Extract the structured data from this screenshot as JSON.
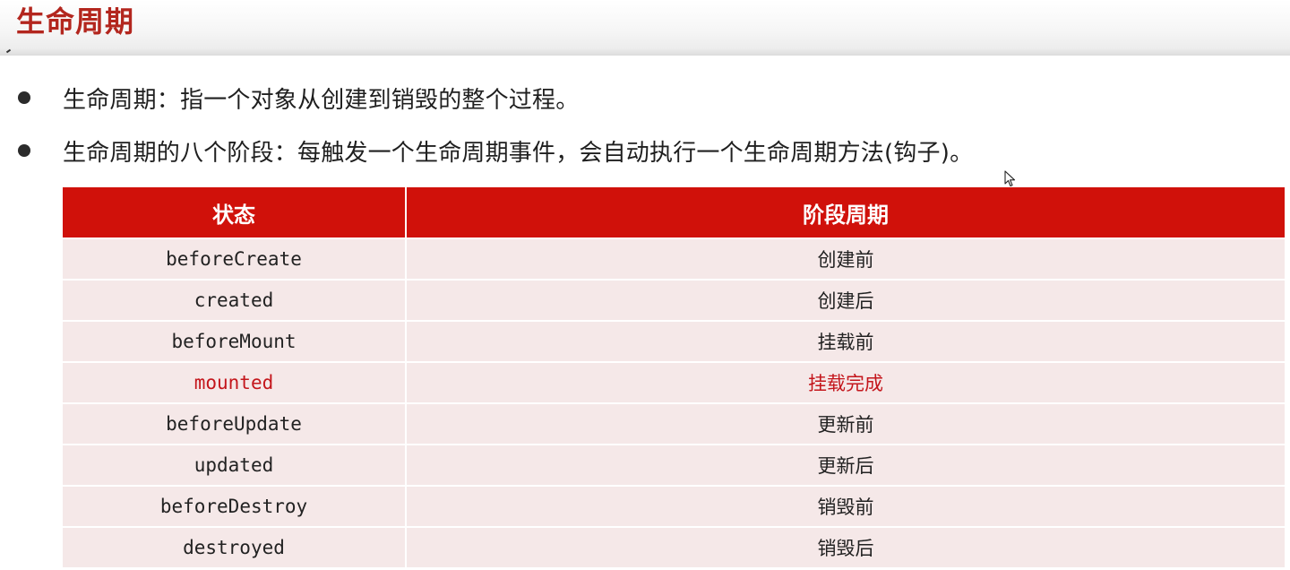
{
  "page": {
    "title": "生命周期"
  },
  "bullets": [
    {
      "text": "生命周期：指一个对象从创建到销毁的整个过程。"
    },
    {
      "text": "生命周期的八个阶段：每触发一个生命周期事件，会自动执行一个生命周期方法(钩子)。"
    }
  ],
  "table": {
    "headers": [
      "状态",
      "阶段周期"
    ],
    "rows": [
      {
        "state": "beforeCreate",
        "phase": "创建前",
        "highlighted": false
      },
      {
        "state": "created",
        "phase": "创建后",
        "highlighted": false
      },
      {
        "state": "beforeMount",
        "phase": "挂载前",
        "highlighted": false
      },
      {
        "state": "mounted",
        "phase": "挂载完成",
        "highlighted": true
      },
      {
        "state": "beforeUpdate",
        "phase": "更新前",
        "highlighted": false
      },
      {
        "state": "updated",
        "phase": "更新后",
        "highlighted": false
      },
      {
        "state": "beforeDestroy",
        "phase": "销毁前",
        "highlighted": false
      },
      {
        "state": "destroyed",
        "phase": "销毁后",
        "highlighted": false
      }
    ]
  },
  "colors": {
    "title": "#b3261e",
    "header_bg": "#d0110a",
    "row_bg": "#f5e8e8",
    "highlight_text": "#c4161c"
  },
  "icons": {
    "cursor": "mouse-pointer-icon",
    "bullet": "bullet-dot-icon"
  }
}
